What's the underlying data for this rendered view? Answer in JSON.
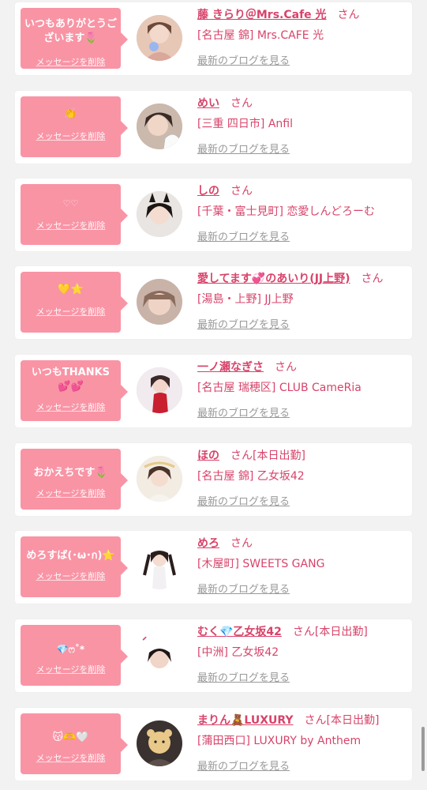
{
  "items": [
    {
      "message": "いつもありがとうございます🌷",
      "delete_label": "メッセージを削除",
      "name": "藤 きらり＠Mrs.Cafe 光",
      "san": "さん",
      "today": "",
      "shop": "[名古屋 錦] Mrs.CAFE 光",
      "blog_label": "最新のブログを見る"
    },
    {
      "message": "👏",
      "delete_label": "メッセージを削除",
      "name": "めい",
      "san": "さん",
      "today": "",
      "shop": "[三重 四日市] Anfil",
      "blog_label": "最新のブログを見る"
    },
    {
      "message": "♡♡",
      "delete_label": "メッセージを削除",
      "name": "しの",
      "san": "さん",
      "today": "",
      "shop": "[千葉・富士見町] 恋愛しんどろーむ",
      "blog_label": "最新のブログを見る"
    },
    {
      "message": "💛⭐",
      "delete_label": "メッセージを削除",
      "name": "愛してます💞のあいり(JJ上野)",
      "san": "さん",
      "today": "",
      "shop": "[湯島・上野] JJ上野",
      "blog_label": "最新のブログを見る"
    },
    {
      "message": "いつもTHANKS💕💕",
      "delete_label": "メッセージを削除",
      "name": "一ノ瀬なぎさ",
      "san": "さん",
      "today": "",
      "shop": "[名古屋 瑞穂区] CLUB CameRia",
      "blog_label": "最新のブログを見る"
    },
    {
      "message": "おかえちです🌷",
      "delete_label": "メッセージを削除",
      "name": "ほの",
      "san": "さん",
      "today": "[本日出勤]",
      "shop": "[名古屋 錦] 乙女坂42",
      "blog_label": "最新のブログを見る"
    },
    {
      "message": "めろすば(･ω･ก)⭐",
      "delete_label": "メッセージを削除",
      "name": "めろ",
      "san": "さん",
      "today": "",
      "shop": "[木屋町] SWEETS GANG",
      "blog_label": "最新のブログを見る"
    },
    {
      "message": "💎ෆ˚*",
      "delete_label": "メッセージを削除",
      "name": "むく💎乙女坂42",
      "san": "さん",
      "today": "[本日出勤]",
      "shop": "[中洲] 乙女坂42",
      "blog_label": "最新のブログを見る"
    },
    {
      "message": "😽🫶🤍",
      "delete_label": "メッセージを削除",
      "name": "まりん🧸LUXURY",
      "san": "さん",
      "today": "[本日出勤]",
      "shop": "[蒲田西口] LUXURY by Anthem",
      "blog_label": "最新のブログを見る"
    }
  ],
  "colors": {
    "accent": "#d8436a",
    "bubble": "#f994a5",
    "background": "#f2f2f2",
    "link_gray": "#999999"
  }
}
